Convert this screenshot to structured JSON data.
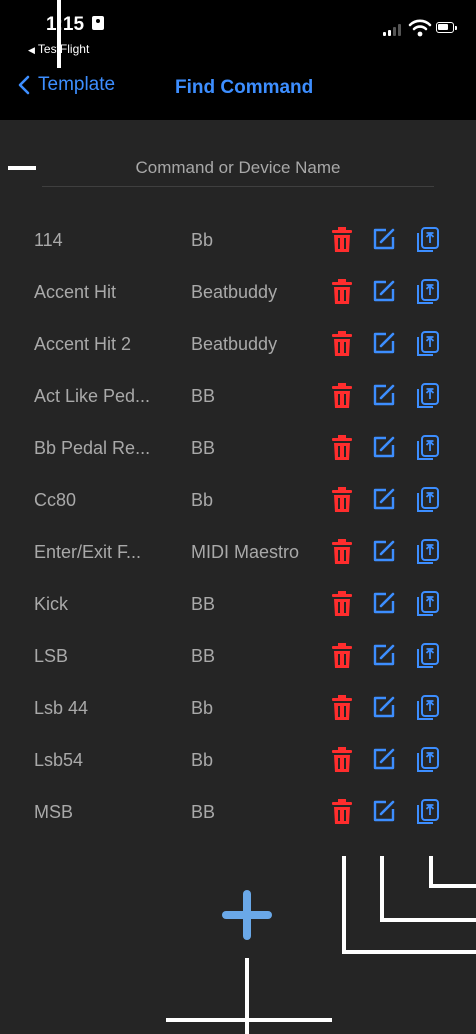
{
  "status_bar": {
    "time": "1:15",
    "back_app_label": "TestFlight"
  },
  "nav": {
    "back_label": "Template",
    "title": "Find Command"
  },
  "search": {
    "placeholder": "Command or Device Name",
    "value": ""
  },
  "commands": [
    {
      "name": "114",
      "device": "Bb"
    },
    {
      "name": "Accent Hit",
      "device": "Beatbuddy"
    },
    {
      "name": "Accent Hit 2",
      "device": "Beatbuddy"
    },
    {
      "name": "Act Like Ped...",
      "device": "BB"
    },
    {
      "name": "Bb Pedal Re...",
      "device": "BB"
    },
    {
      "name": "Cc80",
      "device": "Bb"
    },
    {
      "name": "Enter/Exit F...",
      "device": "MIDI Maestro"
    },
    {
      "name": "Kick",
      "device": "BB"
    },
    {
      "name": "LSB",
      "device": "BB"
    },
    {
      "name": "Lsb 44",
      "device": "Bb"
    },
    {
      "name": "Lsb54",
      "device": "Bb"
    },
    {
      "name": "MSB",
      "device": "BB"
    }
  ],
  "row_actions": {
    "delete_icon": "trash-icon",
    "edit_icon": "edit-icon",
    "copy_icon": "copy-icon"
  },
  "add_button": {
    "icon": "plus-icon"
  },
  "colors": {
    "accent_blue": "#3d8eff",
    "delete_red": "#ff2d2d",
    "add_blue": "#6aa8e8",
    "background": "#252525",
    "header_background": "#000000",
    "text_gray": "#a9a9a9"
  }
}
